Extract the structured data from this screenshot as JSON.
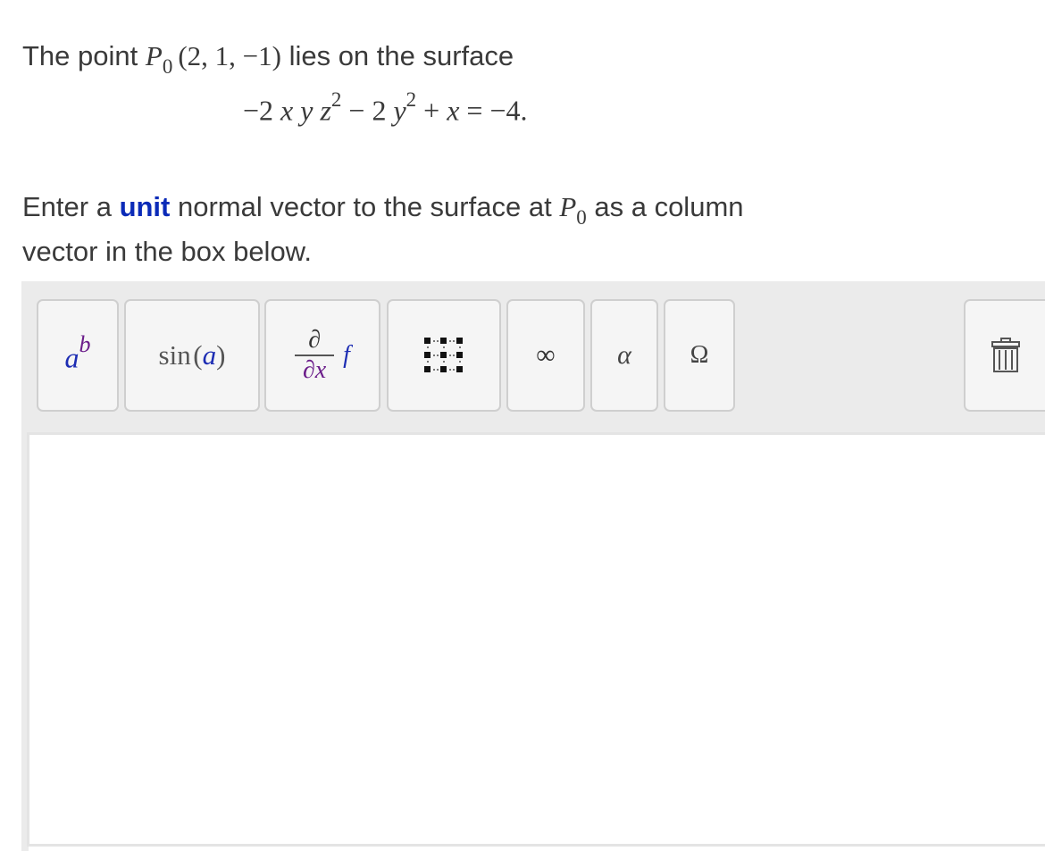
{
  "problem": {
    "line1_prefix": "The point ",
    "point_symbol": "P",
    "point_subscript": "0",
    "point_coords": "(2, 1, −1)",
    "line1_suffix": " lies on the surface",
    "equation": {
      "t1_coef": "−2 ",
      "t1_vars": "x y z",
      "t1_exp": "2",
      "minus": " − 2 ",
      "t2_var": "y",
      "t2_exp": "2",
      "plus": " + ",
      "t3_var": "x",
      "rhs": " = −4."
    },
    "line2_prefix": "Enter a ",
    "unit_word": "unit",
    "line2_middle": " normal vector to the surface at ",
    "line2_suffix": " as a column",
    "line3": "vector in the box below."
  },
  "toolbar": {
    "buttons": [
      {
        "name": "exponent-button",
        "icon": "power-icon",
        "base": "a",
        "exp": "b"
      },
      {
        "name": "function-button",
        "icon": "sin-icon",
        "fn": "sin",
        "arg": "a"
      },
      {
        "name": "calculus-button",
        "icon": "derivative-icon",
        "num": "∂",
        "den": "∂x",
        "f": "f"
      },
      {
        "name": "matrix-button",
        "icon": "matrix-icon"
      },
      {
        "name": "infinity-button",
        "icon": "infinity-icon",
        "glyph": "∞"
      },
      {
        "name": "greek-button",
        "icon": "alpha-icon",
        "glyph": "α"
      },
      {
        "name": "symbols-button",
        "icon": "omega-icon",
        "glyph": "Ω"
      },
      {
        "name": "trash-button",
        "icon": "trash-icon"
      }
    ]
  },
  "colors": {
    "unit_word": "#0b2bb8",
    "exp_base": "#1d2db3",
    "exp_power": "#6b1d8a",
    "toolbar_bg": "#ebebeb"
  },
  "editor": {
    "value": ""
  }
}
